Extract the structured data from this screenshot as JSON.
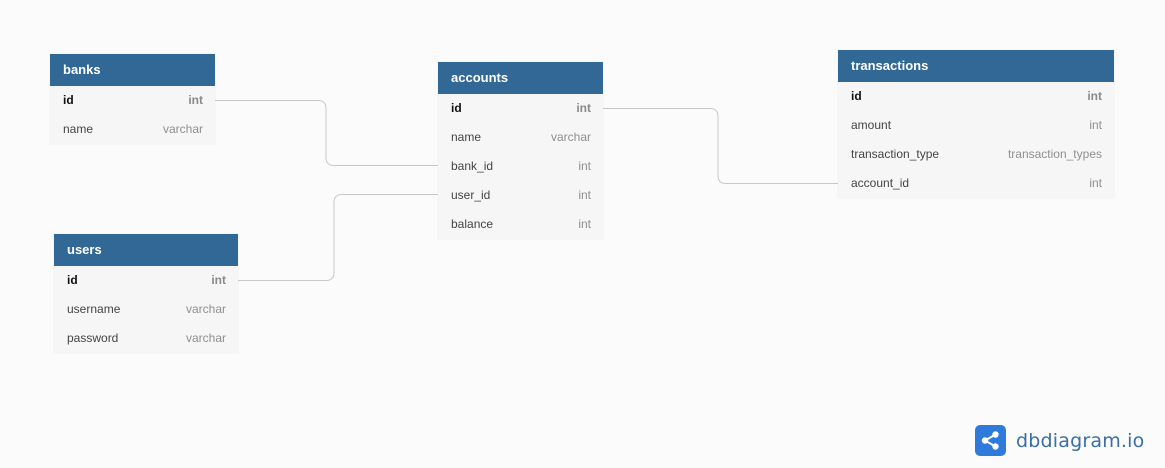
{
  "tables": {
    "banks": {
      "name": "banks",
      "fields": [
        {
          "name": "id",
          "type": "int",
          "pk": true
        },
        {
          "name": "name",
          "type": "varchar",
          "pk": false
        }
      ]
    },
    "accounts": {
      "name": "accounts",
      "fields": [
        {
          "name": "id",
          "type": "int",
          "pk": true
        },
        {
          "name": "name",
          "type": "varchar",
          "pk": false
        },
        {
          "name": "bank_id",
          "type": "int",
          "pk": false
        },
        {
          "name": "user_id",
          "type": "int",
          "pk": false
        },
        {
          "name": "balance",
          "type": "int",
          "pk": false
        }
      ]
    },
    "transactions": {
      "name": "transactions",
      "fields": [
        {
          "name": "id",
          "type": "int",
          "pk": true
        },
        {
          "name": "amount",
          "type": "int",
          "pk": false
        },
        {
          "name": "transaction_type",
          "type": "transaction_types",
          "pk": false
        },
        {
          "name": "account_id",
          "type": "int",
          "pk": false
        }
      ]
    },
    "users": {
      "name": "users",
      "fields": [
        {
          "name": "id",
          "type": "int",
          "pk": true
        },
        {
          "name": "username",
          "type": "varchar",
          "pk": false
        },
        {
          "name": "password",
          "type": "varchar",
          "pk": false
        }
      ]
    }
  },
  "relationships": [
    {
      "from": "banks.id",
      "to": "accounts.bank_id"
    },
    {
      "from": "users.id",
      "to": "accounts.user_id"
    },
    {
      "from": "accounts.id",
      "to": "transactions.account_id"
    }
  ],
  "brand": {
    "text": "dbdiagram.io",
    "color": "#2f7bdc",
    "icon": "share-nodes-icon"
  },
  "colors": {
    "table_header": "#316896",
    "table_body": "#f6f6f6",
    "connector": "#c8c8c8"
  }
}
